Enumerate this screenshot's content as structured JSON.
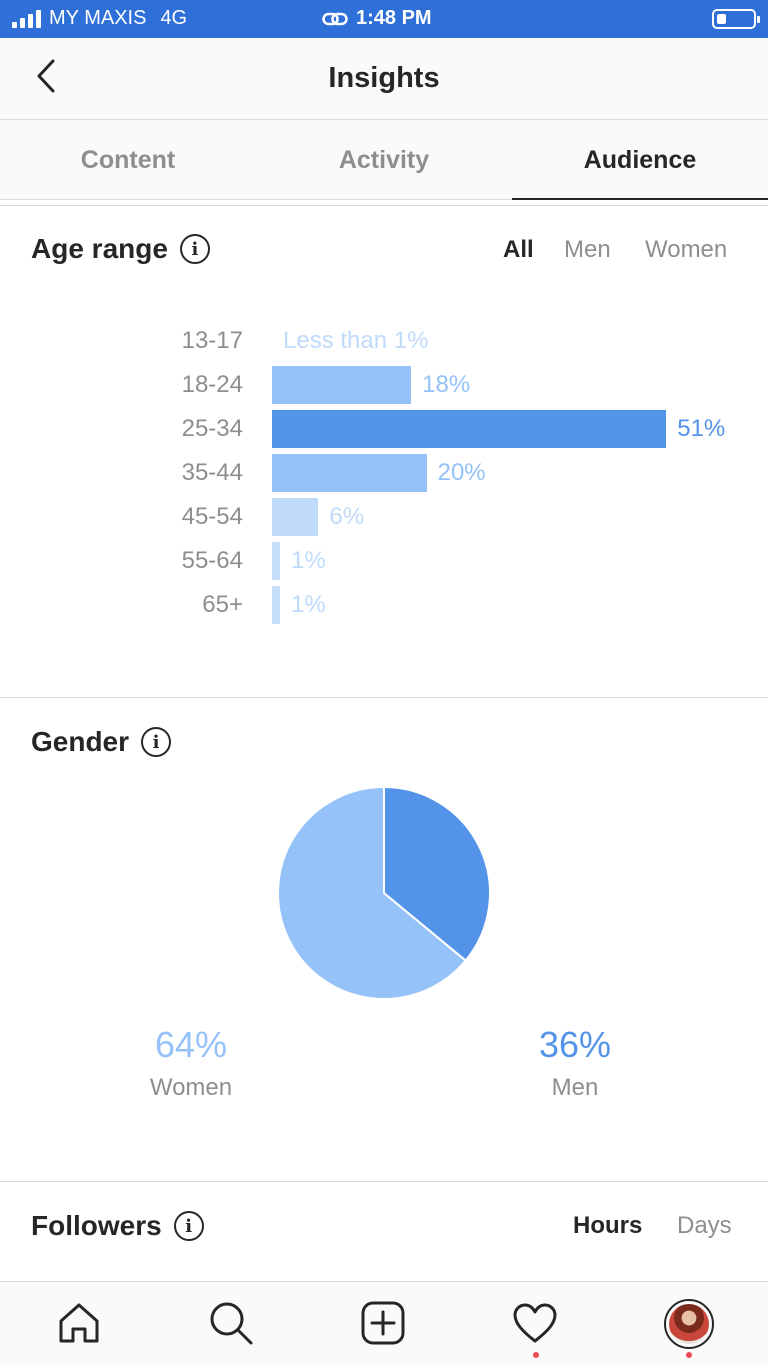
{
  "status_bar": {
    "carrier": "MY MAXIS",
    "network": "4G",
    "time": "1:48 PM"
  },
  "header": {
    "title": "Insights",
    "back_icon": "chevron-left-icon"
  },
  "tabs": [
    {
      "label": "Content",
      "active": false
    },
    {
      "label": "Activity",
      "active": false
    },
    {
      "label": "Audience",
      "active": true
    }
  ],
  "age_range": {
    "title": "Age range",
    "filters": [
      {
        "label": "All",
        "active": true
      },
      {
        "label": "Men",
        "active": false
      },
      {
        "label": "Women",
        "active": false
      }
    ],
    "rows": [
      {
        "label": "13-17",
        "value": 0,
        "value_label": "Less than 1%",
        "color": "#c7defb"
      },
      {
        "label": "18-24",
        "value": 18,
        "value_label": "18%",
        "color": "#95c2f8"
      },
      {
        "label": "25-34",
        "value": 51,
        "value_label": "51%",
        "color": "#5494e8"
      },
      {
        "label": "35-44",
        "value": 20,
        "value_label": "20%",
        "color": "#95c2f8"
      },
      {
        "label": "45-54",
        "value": 6,
        "value_label": "6%",
        "color": "#c0dafb"
      },
      {
        "label": "55-64",
        "value": 1,
        "value_label": "1%",
        "color": "#c7defb"
      },
      {
        "label": "65+",
        "value": 1,
        "value_label": "1%",
        "color": "#c7defb"
      }
    ]
  },
  "gender": {
    "title": "Gender",
    "women": {
      "pct": "64%",
      "label": "Women",
      "value": 64,
      "color": "#95c2f8"
    },
    "men": {
      "pct": "36%",
      "label": "Men",
      "value": 36,
      "color": "#5494e8"
    }
  },
  "followers": {
    "title": "Followers",
    "filters": [
      {
        "label": "Hours",
        "active": true
      },
      {
        "label": "Days",
        "active": false
      }
    ]
  },
  "bottom_nav": {
    "items": [
      "home-icon",
      "search-icon",
      "add-post-icon",
      "activity-heart-icon",
      "profile-avatar"
    ]
  }
}
